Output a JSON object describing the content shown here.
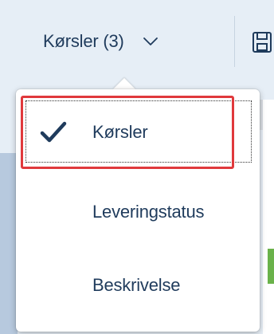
{
  "toolbar": {
    "trigger_label": "Kørsler (3)",
    "trigger_icon": "chevron-down-icon",
    "right_icon": "save-icon"
  },
  "menu": {
    "items": [
      {
        "label": "Kørsler",
        "selected": true,
        "icon": "check-icon"
      },
      {
        "label": "Leveringstatus",
        "selected": false
      },
      {
        "label": "Beskrivelse",
        "selected": false
      }
    ]
  },
  "colors": {
    "text": "#1f3b5c",
    "highlight": "#e0393c",
    "background": "#e6eef6",
    "checkmark": "#1f3b5c"
  }
}
